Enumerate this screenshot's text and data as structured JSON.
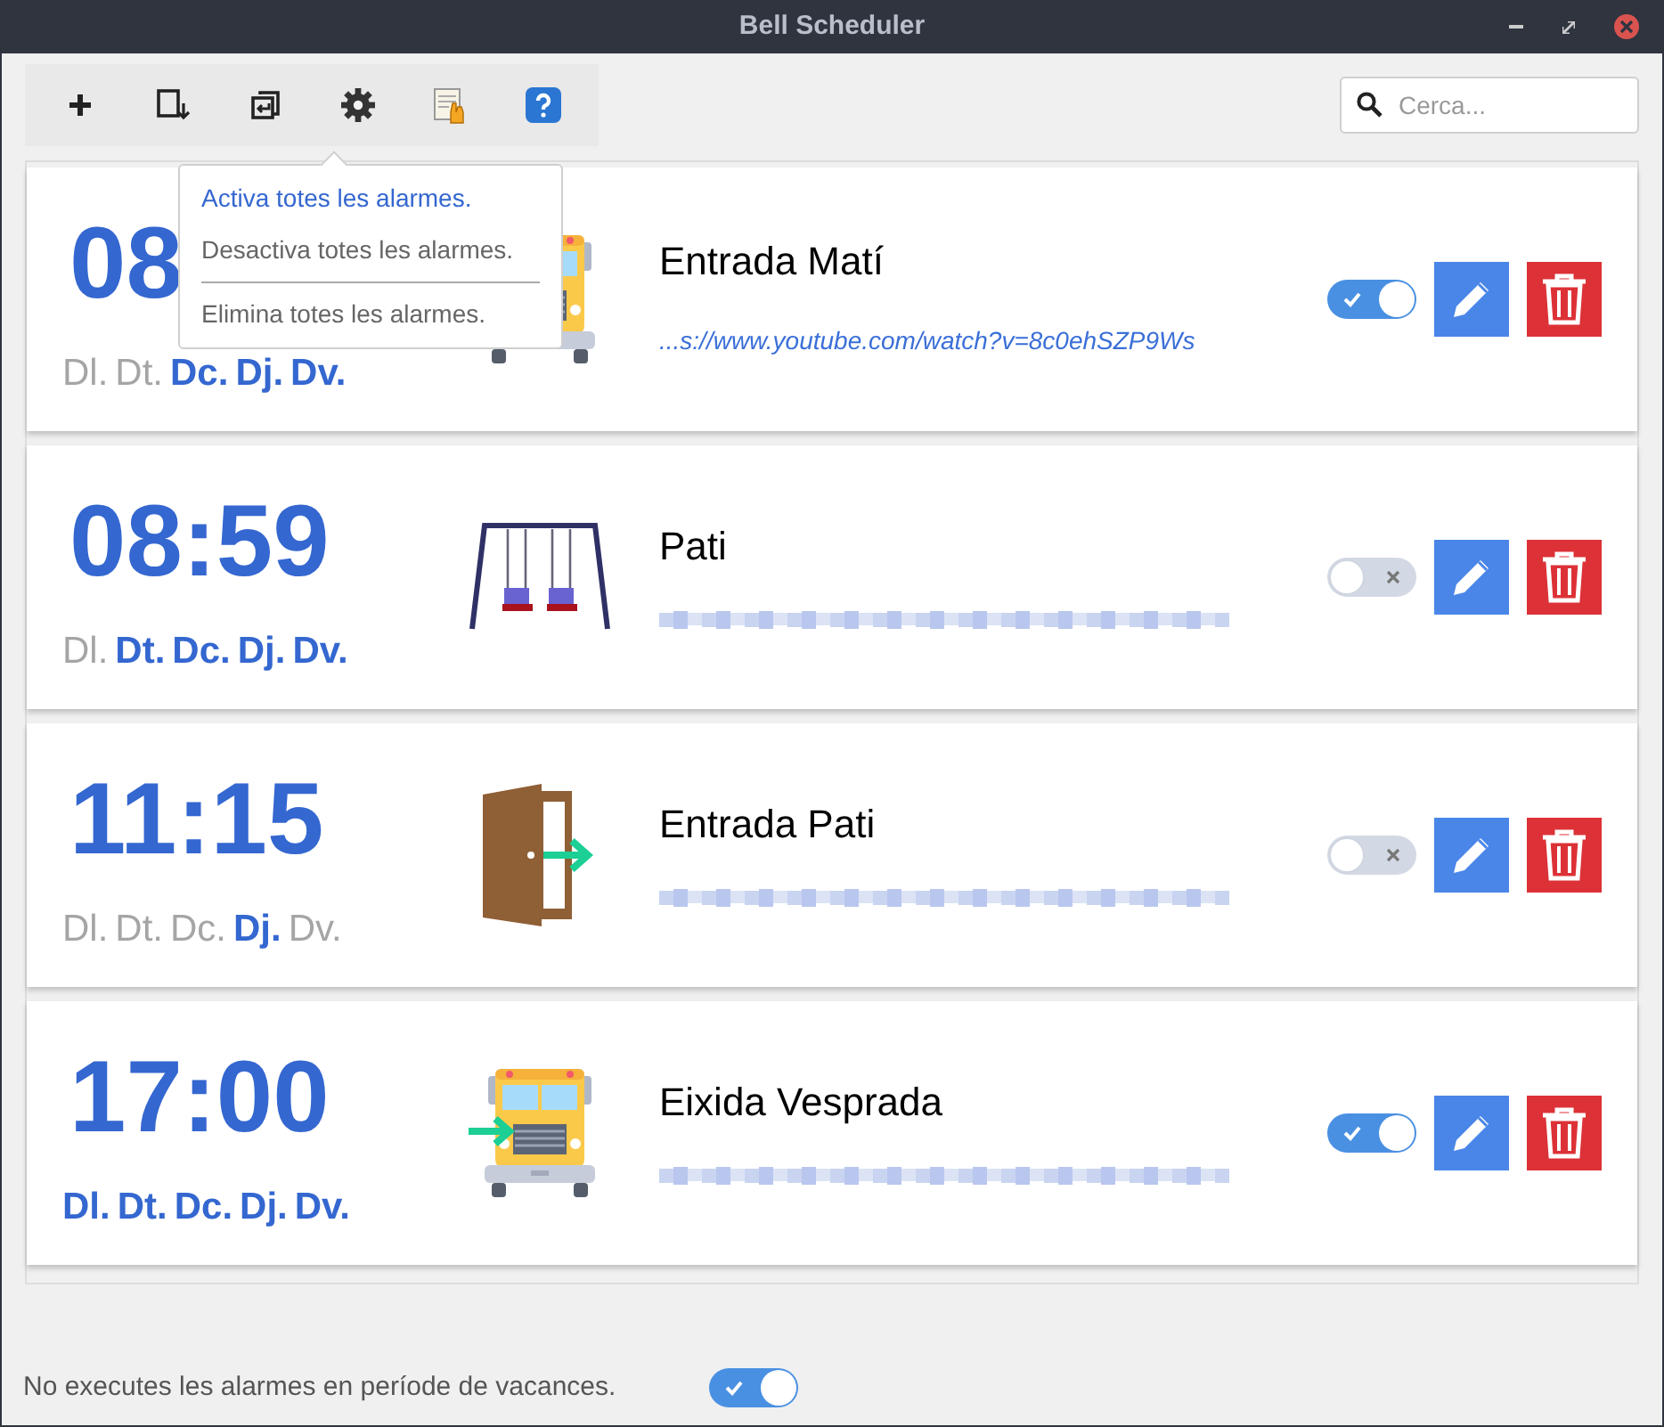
{
  "window": {
    "title": "Bell Scheduler"
  },
  "toolbar": {
    "buttons": [
      {
        "kind": "add"
      },
      {
        "kind": "export"
      },
      {
        "kind": "import"
      },
      {
        "kind": "settings"
      },
      {
        "kind": "manual"
      },
      {
        "kind": "help"
      }
    ]
  },
  "search": {
    "placeholder": "Cerca..."
  },
  "menu": {
    "items": [
      {
        "label": "Activa totes les alarmes.",
        "selected": true
      },
      {
        "label": "Desactiva totes les alarmes.",
        "selected": false
      },
      {
        "label": "Elimina totes les alarmes.",
        "selected": false,
        "separator_before": true
      }
    ]
  },
  "alarms": [
    {
      "time": "08",
      "kind": "bus",
      "name": "Entrada Matí",
      "link": "...s://www.youtube.com/watch?v=8c0ehSZP9Ws",
      "on": true,
      "days": [
        {
          "label": "Dl.",
          "active": false
        },
        {
          "label": "Dt.",
          "active": false
        },
        {
          "label": "Dc.",
          "active": true
        },
        {
          "label": "Dj.",
          "active": true
        },
        {
          "label": "Dv.",
          "active": true
        }
      ]
    },
    {
      "time": "08:59",
      "kind": "swing",
      "name": "Pati",
      "on": false,
      "days": [
        {
          "label": "Dl.",
          "active": false
        },
        {
          "label": "Dt.",
          "active": true
        },
        {
          "label": "Dc.",
          "active": true
        },
        {
          "label": "Dj.",
          "active": true
        },
        {
          "label": "Dv.",
          "active": true
        }
      ]
    },
    {
      "time": "11:15",
      "kind": "door",
      "name": "Entrada Pati",
      "on": false,
      "days": [
        {
          "label": "Dl.",
          "active": false
        },
        {
          "label": "Dt.",
          "active": false
        },
        {
          "label": "Dc.",
          "active": false
        },
        {
          "label": "Dj.",
          "active": true
        },
        {
          "label": "Dv.",
          "active": false
        }
      ]
    },
    {
      "time": "17:00",
      "kind": "bus_arrow",
      "name": "Eixida Vesprada",
      "on": true,
      "days": [
        {
          "label": "Dl.",
          "active": true
        },
        {
          "label": "Dt.",
          "active": true
        },
        {
          "label": "Dc.",
          "active": true
        },
        {
          "label": "Dj.",
          "active": true
        },
        {
          "label": "Dv.",
          "active": true
        }
      ]
    }
  ],
  "footer": {
    "label": "No executes les alarmes en període de vacances.",
    "on": true
  }
}
